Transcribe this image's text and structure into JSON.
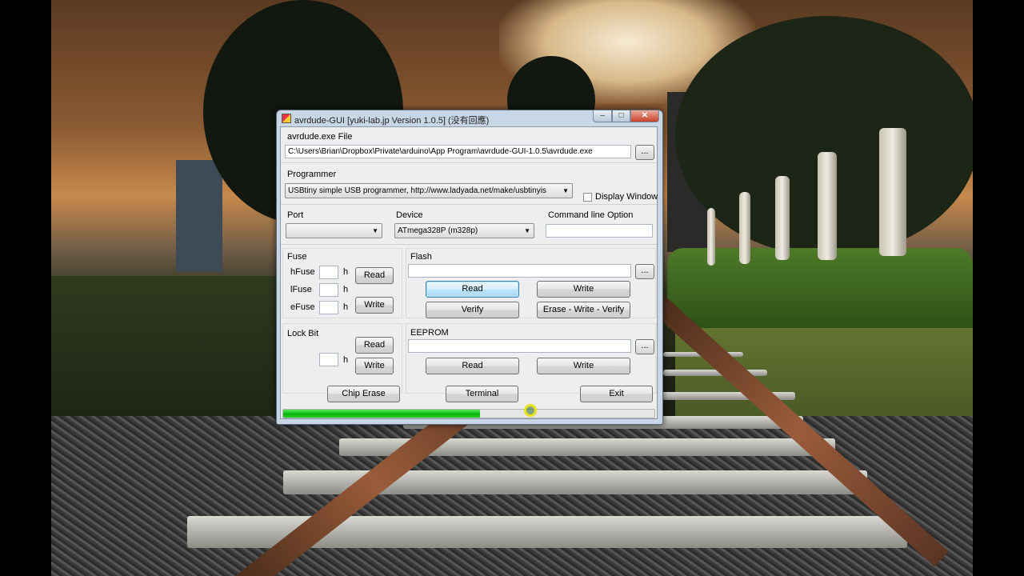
{
  "window": {
    "title": "avrdude-GUI [yuki-lab.jp Version 1.0.5] (没有回應)",
    "controls": {
      "minimize": "–",
      "maximize": "□",
      "close": "✕"
    }
  },
  "exe": {
    "label": "avrdude.exe File",
    "path": "C:\\Users\\Brian\\Dropbox\\Private\\arduino\\App Program\\avrdude-GUI-1.0.5\\avrdude.exe",
    "browse": "..."
  },
  "programmer": {
    "label": "Programmer",
    "selected": "USBtiny simple USB programmer, http://www.ladyada.net/make/usbtinyis",
    "display_window_label": "Display Window",
    "display_window_checked": false
  },
  "port": {
    "label": "Port",
    "selected": ""
  },
  "device": {
    "label": "Device",
    "selected": "ATmega328P (m328p)"
  },
  "cmdline": {
    "label": "Command line Option",
    "value": ""
  },
  "fuse": {
    "label": "Fuse",
    "rows": [
      {
        "name": "hFuse",
        "value": "",
        "unit": "h"
      },
      {
        "name": "lFuse",
        "value": "",
        "unit": "h"
      },
      {
        "name": "eFuse",
        "value": "",
        "unit": "h"
      }
    ],
    "read": "Read",
    "write": "Write"
  },
  "flash": {
    "label": "Flash",
    "path": "",
    "browse": "...",
    "read": "Read",
    "write": "Write",
    "verify": "Verify",
    "erase_write_verify": "Erase - Write - Verify"
  },
  "lockbit": {
    "label": "Lock Bit",
    "value": "",
    "unit": "h",
    "read": "Read",
    "write": "Write"
  },
  "eeprom": {
    "label": "EEPROM",
    "path": "",
    "browse": "...",
    "read": "Read",
    "write": "Write"
  },
  "actions": {
    "chip_erase": "Chip Erase",
    "terminal": "Terminal",
    "exit": "Exit"
  },
  "progress": {
    "fraction": 0.53,
    "color": "#10c010"
  },
  "icons": {
    "app": "avrdude-app-icon",
    "dropdown": "chevron-down-icon",
    "cursor": "busy-cursor-icon"
  }
}
